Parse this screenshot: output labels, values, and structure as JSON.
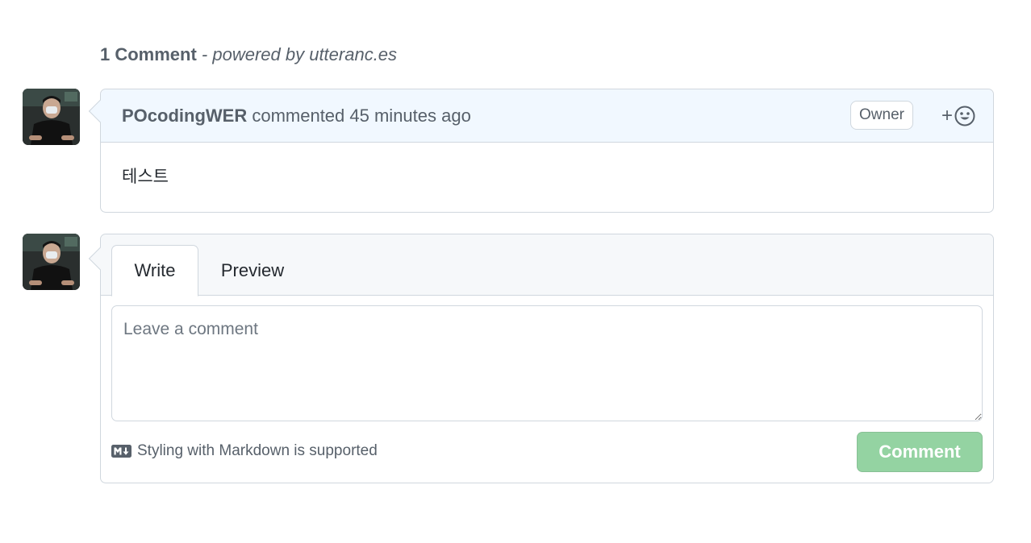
{
  "header": {
    "count_label": "1 Comment",
    "powered_prefix": " - powered by ",
    "powered_link": "utteranc.es"
  },
  "comments": [
    {
      "author": "POcodingWER",
      "action": " commented ",
      "time": "45 minutes ago",
      "badge": "Owner",
      "reaction_plus": "+",
      "body": "테스트"
    }
  ],
  "editor": {
    "tab_write": "Write",
    "tab_preview": "Preview",
    "placeholder": "Leave a comment",
    "markdown_hint": "Styling with Markdown is supported",
    "submit_label": "Comment",
    "submit_color": "#94d3a2"
  },
  "icons": {
    "reaction": "smiley-icon",
    "markdown": "markdown-icon"
  }
}
